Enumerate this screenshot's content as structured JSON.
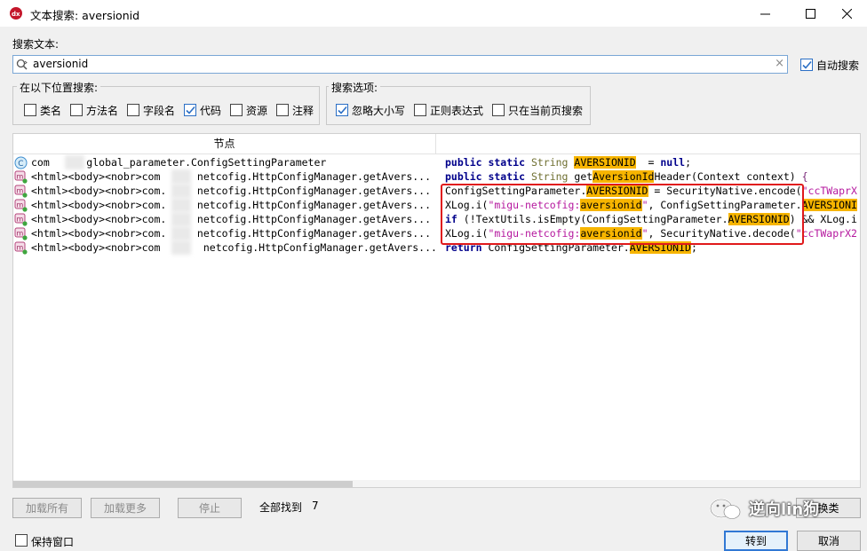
{
  "window": {
    "title": "文本搜索: aversionid"
  },
  "search": {
    "label": "搜索文本:",
    "value": "aversionid",
    "auto_search_label": "自动搜索",
    "auto_search_checked": true
  },
  "location_group": {
    "title": "在以下位置搜索:",
    "options": [
      {
        "label": "类名",
        "checked": false
      },
      {
        "label": "方法名",
        "checked": false
      },
      {
        "label": "字段名",
        "checked": false
      },
      {
        "label": "代码",
        "checked": true
      },
      {
        "label": "资源",
        "checked": false
      },
      {
        "label": "注释",
        "checked": false
      }
    ]
  },
  "options_group": {
    "title": "搜索选项:",
    "options": [
      {
        "label": "忽略大小写",
        "checked": true
      },
      {
        "label": "正则表达式",
        "checked": false
      },
      {
        "label": "只在当前页搜索",
        "checked": false
      }
    ]
  },
  "results": {
    "header_node": "节点",
    "rows": [
      {
        "icon": "class-icon",
        "node": "com      global_parameter.ConfigSettingParameter",
        "code_parts": [
          [
            "kw",
            "public static "
          ],
          [
            "ty",
            "String "
          ],
          [
            "hl",
            "AVERSIONID"
          ],
          [
            "",
            "  = "
          ],
          [
            "kw",
            "null"
          ],
          [
            "",
            ";"
          ]
        ]
      },
      {
        "icon": "method-icon",
        "node": "<html><body><nobr>com      netcofig.HttpConfigManager.getAvers...",
        "code_parts": [
          [
            "kw",
            "public static "
          ],
          [
            "ty",
            "String "
          ],
          [
            "",
            "get"
          ],
          [
            "hl",
            "AversionId"
          ],
          [
            "",
            "Header(Context context) "
          ],
          [
            "pu",
            "{"
          ]
        ]
      },
      {
        "icon": "method-icon",
        "node": "<html><body><nobr>com.     netcofig.HttpConfigManager.getAvers...",
        "code_parts": [
          [
            "",
            "ConfigSettingParameter."
          ],
          [
            "hl",
            "AVERSIONID"
          ],
          [
            "",
            " = SecurityNative.encode("
          ],
          [
            "st",
            "\"ccTWaprX"
          ]
        ]
      },
      {
        "icon": "method-icon",
        "node": "<html><body><nobr>com.     netcofig.HttpConfigManager.getAvers...",
        "code_parts": [
          [
            "",
            "XLog.i("
          ],
          [
            "st",
            "\"migu-netcofig:"
          ],
          [
            "hl",
            "aversionid"
          ],
          [
            "st",
            "\""
          ],
          [
            "",
            ", ConfigSettingParameter."
          ],
          [
            "hl",
            "AVERSIONI"
          ]
        ]
      },
      {
        "icon": "method-icon",
        "node": "<html><body><nobr>com.     netcofig.HttpConfigManager.getAvers...",
        "code_parts": [
          [
            "kw",
            "if "
          ],
          [
            "",
            "(!TextUtils.isEmpty(ConfigSettingParameter."
          ],
          [
            "hl",
            "AVERSIONID"
          ],
          [
            "",
            ") && XLog.i"
          ]
        ]
      },
      {
        "icon": "method-icon",
        "node": "<html><body><nobr>com.     netcofig.HttpConfigManager.getAvers...",
        "code_parts": [
          [
            "",
            "XLog.i("
          ],
          [
            "st",
            "\"migu-netcofig:"
          ],
          [
            "hl",
            "aversionid"
          ],
          [
            "st",
            "\""
          ],
          [
            "",
            ", SecurityNative.decode("
          ],
          [
            "st",
            "\"ccTWaprX2"
          ]
        ]
      },
      {
        "icon": "method-icon",
        "node": "<html><body><nobr>com       netcofig.HttpConfigManager.getAvers...",
        "code_parts": [
          [
            "kw",
            "return "
          ],
          [
            "",
            "ConfigSettingParameter."
          ],
          [
            "hl",
            "AVERSIONID"
          ],
          [
            "",
            ";"
          ]
        ]
      }
    ]
  },
  "footer": {
    "load_all": "加载所有",
    "load_more": "加载更多",
    "stop": "停止",
    "found_label": "全部找到",
    "found_count": "7",
    "keep_window": "保持窗口",
    "goto": "转到",
    "cancel": "取消",
    "watermark": "逆向lin狗",
    "partial_button": "换类"
  }
}
